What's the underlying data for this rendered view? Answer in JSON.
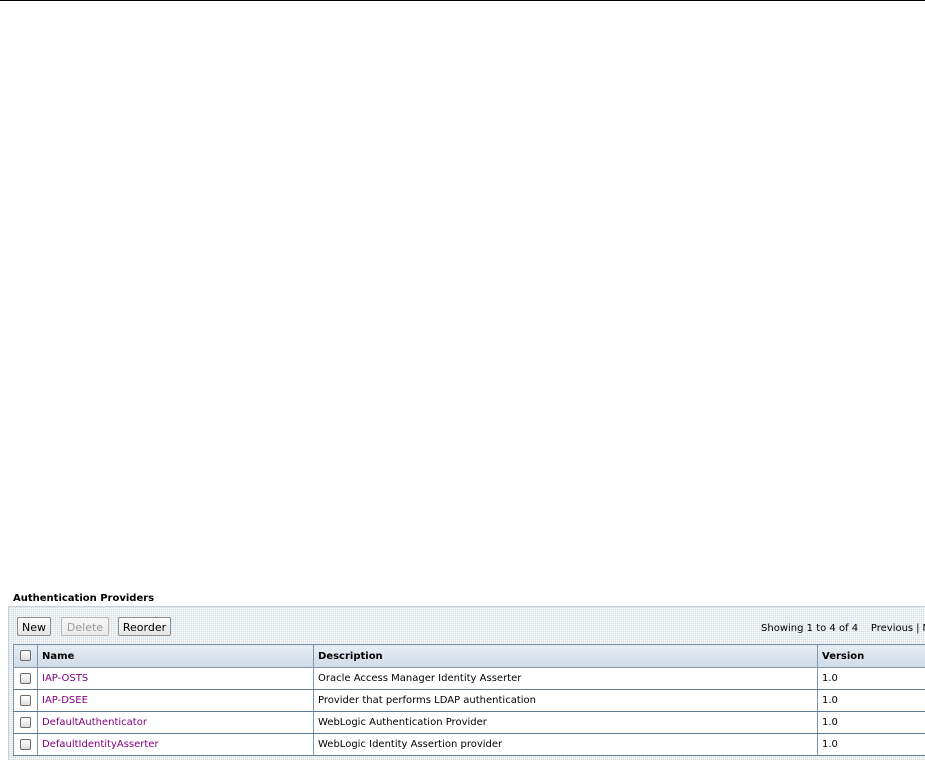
{
  "section": {
    "title": "Authentication Providers"
  },
  "toolbar": {
    "new_label": "New",
    "delete_label": "Delete",
    "reorder_label": "Reorder",
    "paging_showing": "Showing 1 to 4 of 4",
    "paging_previous": "Previous",
    "paging_separator": "|",
    "paging_next_partial": "N"
  },
  "table": {
    "columns": [
      "Name",
      "Description",
      "Version"
    ],
    "rows": [
      {
        "name": "IAP-OSTS",
        "description": "Oracle Access Manager Identity Asserter",
        "version": "1.0"
      },
      {
        "name": "IAP-DSEE",
        "description": "Provider that performs LDAP authentication",
        "version": "1.0"
      },
      {
        "name": "DefaultAuthenticator",
        "description": "WebLogic Authentication Provider",
        "version": "1.0"
      },
      {
        "name": "DefaultIdentityAsserter",
        "description": "WebLogic Identity Assertion provider",
        "version": "1.0"
      }
    ]
  },
  "colors": {
    "link": "#800080",
    "header_bg": "#d8e2ec",
    "border": "#7f96ad"
  }
}
